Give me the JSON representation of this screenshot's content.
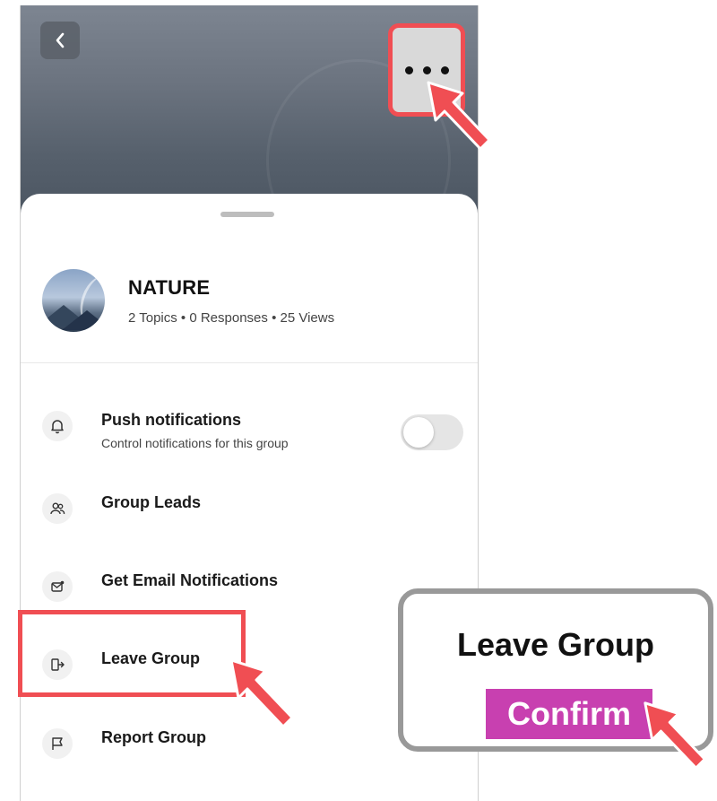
{
  "header": {
    "back_icon": "chevron-left-icon",
    "more_icon": "more-horizontal-icon"
  },
  "group": {
    "name": "NATURE",
    "stats": "2 Topics • 0 Responses • 25 Views"
  },
  "menu": {
    "push": {
      "label": "Push notifications",
      "sub": "Control notifications for this group",
      "enabled": false
    },
    "leads": {
      "label": "Group Leads"
    },
    "email": {
      "label": "Get Email Notifications"
    },
    "leave": {
      "label": "Leave Group"
    },
    "report": {
      "label": "Report Group"
    }
  },
  "callout": {
    "title": "Leave Group",
    "confirm_label": "Confirm"
  },
  "colors": {
    "highlight": "#f04e53",
    "confirm_bg": "#c840b0",
    "callout_border": "#999999"
  }
}
